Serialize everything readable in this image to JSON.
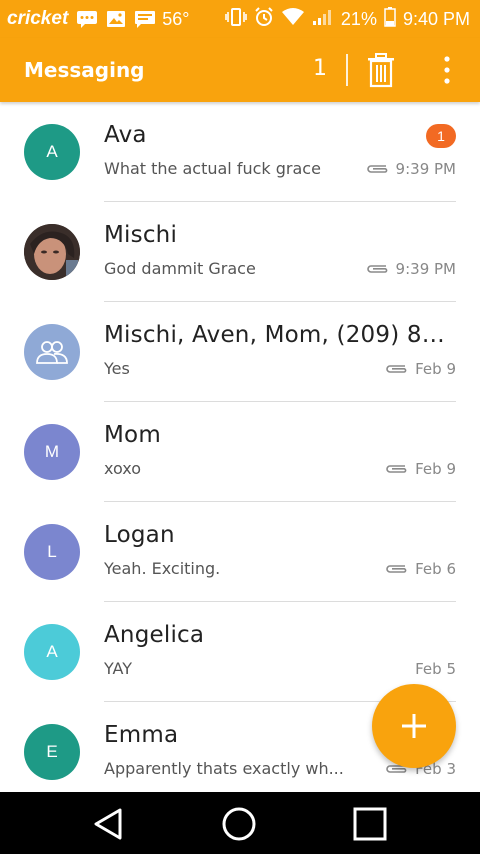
{
  "status_bar": {
    "carrier": "cricket",
    "temperature": "56°",
    "battery": "21%",
    "time": "9:40 PM"
  },
  "app_bar": {
    "title": "Messaging",
    "selected_count": "1"
  },
  "conversations": [
    {
      "name": "Ava",
      "preview": "What the actual fuck grace",
      "time": "9:39 PM",
      "initial": "A",
      "avatar_color": "#1e9a86",
      "unread": "1",
      "attachment": true
    },
    {
      "name": "Mischi",
      "preview": "God dammit Grace",
      "time": "9:39 PM",
      "initial": "",
      "avatar_color": "#5a4a42",
      "attachment": true
    },
    {
      "name": "Mischi, Aven, Mom, (209) 81...",
      "preview": "Yes",
      "time": "Feb 9",
      "initial": "",
      "avatar_color": "#8fa9d6",
      "attachment": true
    },
    {
      "name": "Mom",
      "preview": "xoxo",
      "time": "Feb 9",
      "initial": "M",
      "avatar_color": "#7b86cf",
      "attachment": true
    },
    {
      "name": "Logan",
      "preview": "Yeah. Exciting.",
      "time": "Feb 6",
      "initial": "L",
      "avatar_color": "#7b86cf",
      "attachment": true
    },
    {
      "name": "Angelica",
      "preview": "YAY",
      "time": "Feb 5",
      "initial": "A",
      "avatar_color": "#4ccbd8",
      "attachment": false
    },
    {
      "name": "Emma",
      "preview": "Apparently thats exactly wh...",
      "time": "Feb 3",
      "initial": "E",
      "avatar_color": "#1e9a86",
      "attachment": true
    }
  ],
  "colors": {
    "accent": "#f9a30d",
    "badge": "#f26a23"
  }
}
